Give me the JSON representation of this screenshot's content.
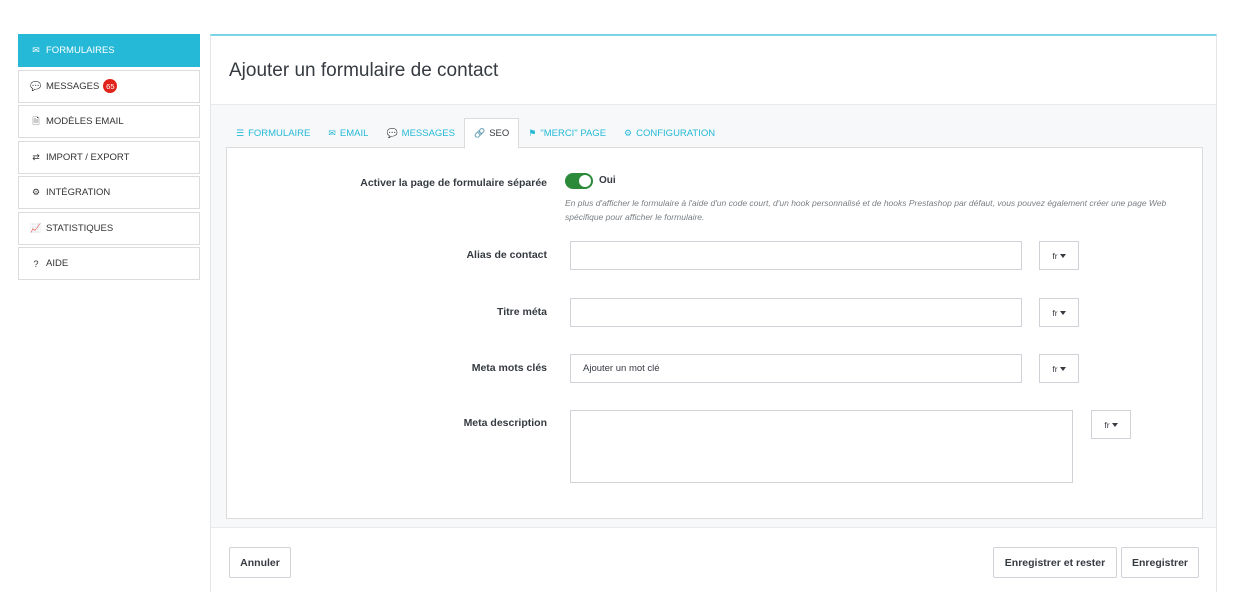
{
  "sidebar": {
    "items": [
      {
        "label": "FORMULAIRES",
        "icon": "envelope-icon",
        "glyph": "✉",
        "active": true
      },
      {
        "label": "MESSAGES",
        "icon": "comments-icon",
        "glyph": "💬",
        "badge": "65"
      },
      {
        "label": "MODÈLES EMAIL",
        "icon": "file-text-icon",
        "glyph": "🗎"
      },
      {
        "label": "IMPORT / EXPORT",
        "icon": "exchange-icon",
        "glyph": "⇄"
      },
      {
        "label": "INTÉGRATION",
        "icon": "cogs-icon",
        "glyph": "⚙"
      },
      {
        "label": "STATISTIQUES",
        "icon": "line-chart-icon",
        "glyph": "📈"
      },
      {
        "label": "AIDE",
        "icon": "question-circle-icon",
        "glyph": "?"
      }
    ]
  },
  "panel": {
    "title": "Ajouter un formulaire de contact"
  },
  "tabs": [
    {
      "label": "FORMULAIRE",
      "icon": "list-icon",
      "glyph": "☰"
    },
    {
      "label": "EMAIL",
      "icon": "envelope-icon",
      "glyph": "✉"
    },
    {
      "label": "MESSAGES",
      "icon": "comments-icon",
      "glyph": "💬"
    },
    {
      "label": "SEO",
      "icon": "link-icon",
      "glyph": "🔗",
      "active": true
    },
    {
      "label": "\"MERCI\" PAGE",
      "icon": "flag-icon",
      "glyph": "⚑"
    },
    {
      "label": "CONFIGURATION",
      "icon": "cog-icon",
      "glyph": "⚙"
    }
  ],
  "form": {
    "separate_page": {
      "label": "Activer la page de formulaire séparée",
      "value": "Oui",
      "enabled": true,
      "help": "En plus d'afficher le formulaire à l'aide d'un code court, d'un hook personnalisé et de hooks Prestashop par défaut, vous pouvez également créer une page Web spécifique pour afficher le formulaire."
    },
    "alias": {
      "label": "Alias de contact",
      "value": "",
      "lang": "fr"
    },
    "meta_title": {
      "label": "Titre méta",
      "value": "",
      "lang": "fr"
    },
    "meta_keywords": {
      "label": "Meta mots clés",
      "placeholder": "Ajouter un mot clé",
      "lang": "fr"
    },
    "meta_description": {
      "label": "Meta description",
      "value": "",
      "lang": "fr"
    }
  },
  "footer": {
    "cancel_label": "Annuler",
    "save_stay_label": "Enregistrer et rester",
    "save_label": "Enregistrer"
  },
  "colors": {
    "accent": "#25b9d7",
    "toggle_on": "#2a8a3a",
    "badge": "#e0231b"
  }
}
